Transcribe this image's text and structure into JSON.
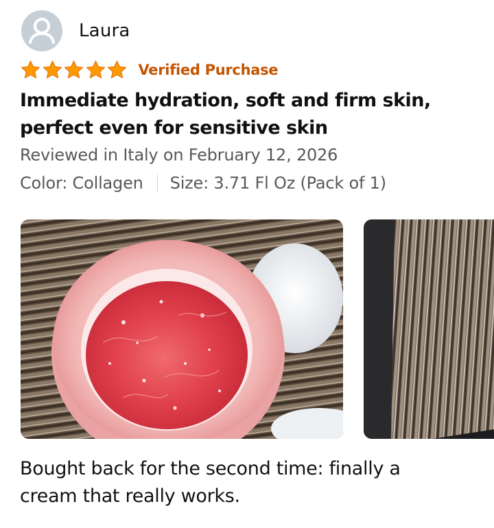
{
  "review": {
    "author": {
      "name": "Laura",
      "avatar_icon": "default-user-avatar-icon"
    },
    "rating": {
      "value": 5,
      "max": 5,
      "star_color": "#ff9900",
      "star_outline": "#e47911"
    },
    "badge": {
      "label": "Verified Purchase",
      "color": "#c45500"
    },
    "title_line1": "Immediate hydration, soft and firm skin,",
    "title_line2": "perfect even for sensitive skin",
    "date_text": "Reviewed in Italy on February 12, 2026",
    "variants": {
      "color": "Color: Collagen",
      "size": "Size: 3.71 Fl Oz (Pack of 1)"
    },
    "images": [
      {
        "name": "review-photo-1"
      },
      {
        "name": "review-photo-2"
      }
    ],
    "body_line1": "Bought back for the second time: finally a",
    "body_line2": "cream that really works."
  }
}
